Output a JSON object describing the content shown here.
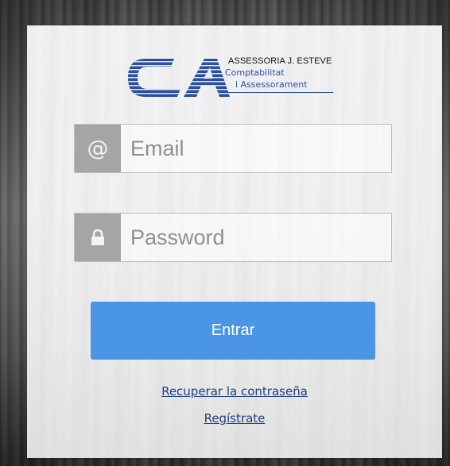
{
  "logo": {
    "mark_letters": "CA",
    "title": "ASSESSORIA J. ESTEVE",
    "subtitle_line1": "Comptabilitat",
    "subtitle_line2": "i Assessorament",
    "brand_color": "#2a4fa0"
  },
  "login": {
    "email": {
      "icon": "at-icon",
      "placeholder": "Email",
      "value": ""
    },
    "password": {
      "icon": "lock-icon",
      "placeholder": "Password",
      "value": ""
    },
    "submit_label": "Entrar",
    "recover_link": "Recuperar la contraseña",
    "register_link": "Regístrate"
  },
  "colors": {
    "button": "#4b95e6",
    "icon_bg": "#a5a5a5",
    "link": "#1e3f82"
  }
}
